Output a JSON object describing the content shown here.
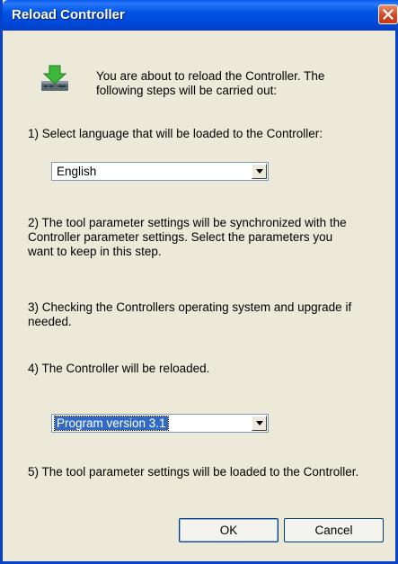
{
  "window": {
    "title": "Reload Controller"
  },
  "intro": {
    "icon": "download-arrow-device-icon",
    "line1": "You are about to reload the Controller. The",
    "line2": "following steps will be carried out:"
  },
  "steps": {
    "step1": "1) Select language that will be loaded to the Controller:",
    "step2_line1": "2) The tool parameter settings will be synchronized with the",
    "step2_line2": "Controller parameter settings. Select the parameters you",
    "step2_line3": "want to keep in this step.",
    "step3_line1": "3) Checking the Controllers operating system and upgrade if",
    "step3_line2": "needed.",
    "step4": "4) The Controller will be reloaded.",
    "step5": "5) The tool parameter settings will be loaded to the Controller."
  },
  "language_select": {
    "value": "English"
  },
  "version_select": {
    "value": "Program version 3.1"
  },
  "buttons": {
    "ok": "OK",
    "cancel": "Cancel"
  },
  "colors": {
    "titlebar": "#0054e3",
    "close": "#d0431f",
    "selection": "#316ac5",
    "face": "#ece9d8"
  }
}
